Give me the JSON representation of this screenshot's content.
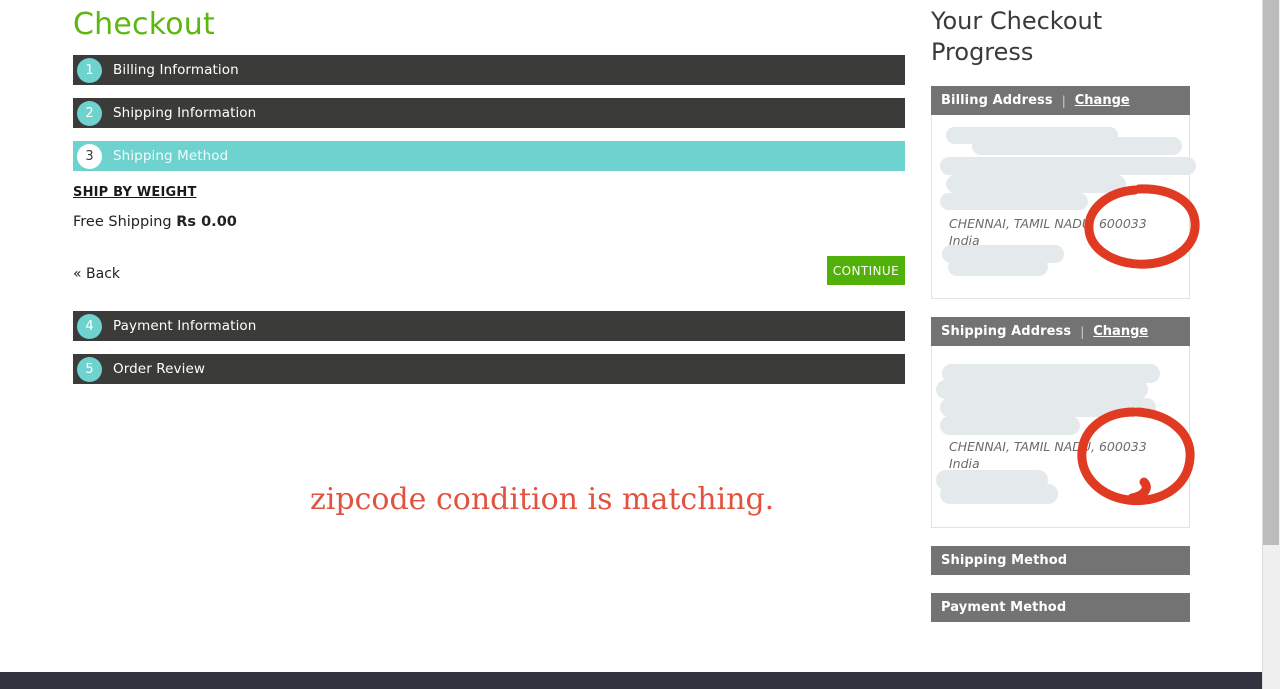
{
  "page": {
    "title": "Checkout",
    "title_color": "#5cb80d"
  },
  "colors": {
    "step_bar": "#3b3b39",
    "step_active": "#6ed3cf",
    "accent_teal": "#6ed3cf",
    "continue_green": "#52b108",
    "sidebar_header_grey": "#737373",
    "annotation_red": "#e2533f",
    "redaction_grey": "#e4e9ec",
    "footer": "#33333f"
  },
  "checkout_steps": [
    {
      "number": "1",
      "label": "Billing Information",
      "state": "collapsed"
    },
    {
      "number": "2",
      "label": "Shipping Information",
      "state": "collapsed"
    },
    {
      "number": "3",
      "label": "Shipping Method",
      "state": "active"
    },
    {
      "number": "4",
      "label": "Payment Information",
      "state": "collapsed"
    },
    {
      "number": "5",
      "label": "Order Review",
      "state": "collapsed"
    }
  ],
  "shipping_method": {
    "group_title": "SHIP BY WEIGHT",
    "option_label": "Free Shipping",
    "option_price": "Rs 0.00",
    "back_label": "« Back",
    "continue_label": "CONTINUE"
  },
  "annotation": {
    "note_text": "zipcode condition is matching.",
    "circled_value_billing": "600033",
    "circled_value_shipping": "600033"
  },
  "sidebar": {
    "title": "Your Checkout Progress",
    "change_label": "Change",
    "separator": "|",
    "blocks": [
      {
        "heading": "Billing Address",
        "has_change": true,
        "address_lines": [
          "CHENNAI, TAMIL NADU, 600033",
          "India"
        ]
      },
      {
        "heading": "Shipping Address",
        "has_change": true,
        "address_lines": [
          "CHENNAI, TAMIL NADU, 600033",
          "India"
        ]
      },
      {
        "heading": "Shipping Method",
        "has_change": false
      },
      {
        "heading": "Payment Method",
        "has_change": false
      }
    ]
  }
}
